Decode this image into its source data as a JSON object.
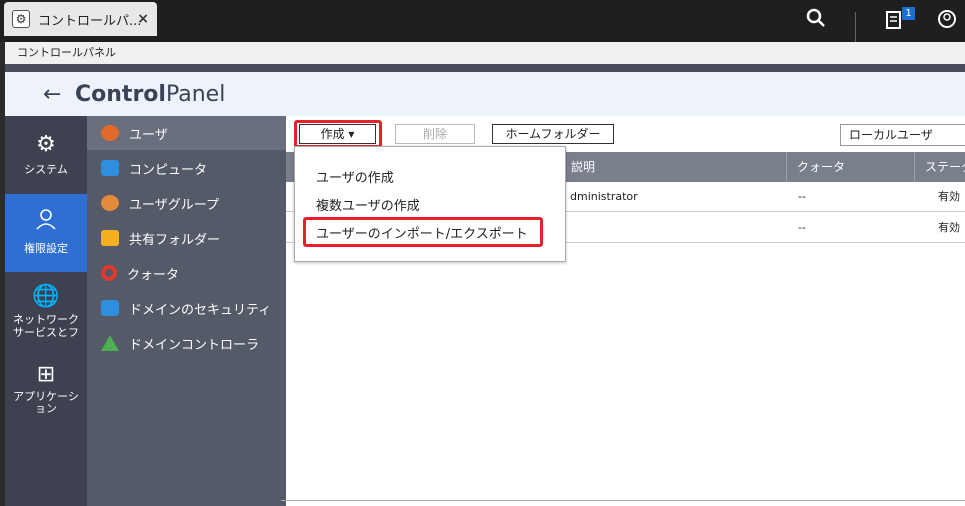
{
  "browser": {
    "tab_title": "コントロールパ...",
    "tab_close": "×",
    "notification_count": "1"
  },
  "window": {
    "title": "コントロールパネル",
    "header": {
      "brand_bold": "Control",
      "brand_light": "Panel"
    }
  },
  "nav_primary": [
    {
      "label": "システム",
      "icon": "gear-icon"
    },
    {
      "label": "権限設定",
      "icon": "user-icon",
      "active": true
    },
    {
      "label": "ネットワーク\nサービスとフ",
      "icon": "globe-icon"
    },
    {
      "label": "アプリケーション",
      "icon": "grid-icon"
    }
  ],
  "nav_secondary": [
    {
      "label": "ユーザ",
      "icon": "user-icon",
      "color": "#e06a2a",
      "active": true
    },
    {
      "label": "コンピュータ",
      "icon": "computer-icon",
      "color": "#2e8fe0"
    },
    {
      "label": "ユーザグループ",
      "icon": "user-group-icon",
      "color": "#e08a3a"
    },
    {
      "label": "共有フォルダー",
      "icon": "folder-icon",
      "color": "#f4b01e"
    },
    {
      "label": "クォータ",
      "icon": "quota-icon",
      "color": "#e3392c"
    },
    {
      "label": "ドメインのセキュリティ",
      "icon": "domain-security-icon",
      "color": "#2e8fe0"
    },
    {
      "label": "ドメインコントローラ",
      "icon": "domain-controller-icon",
      "color": "#4caf50"
    }
  ],
  "toolbar": {
    "create_label": "作成",
    "delete_label": "削除",
    "home_folder_label": "ホームフォルダー",
    "user_type_selected": "ローカルユーザ"
  },
  "table": {
    "headers": [
      "説明",
      "クォータ",
      "ステータ"
    ],
    "rows": [
      {
        "description": "dministrator",
        "quota": "--",
        "status": "有効"
      },
      {
        "description": "",
        "quota": "--",
        "status": "有効"
      }
    ]
  },
  "create_menu": {
    "items": [
      "ユーザの作成",
      "複数ユーザの作成",
      "ユーザーのインポート/エクスポート"
    ]
  },
  "colors": {
    "accent": "#2f6fd1",
    "highlight": "#e8202a",
    "nav_dark": "#3d4150",
    "nav_mid": "#555a68"
  }
}
